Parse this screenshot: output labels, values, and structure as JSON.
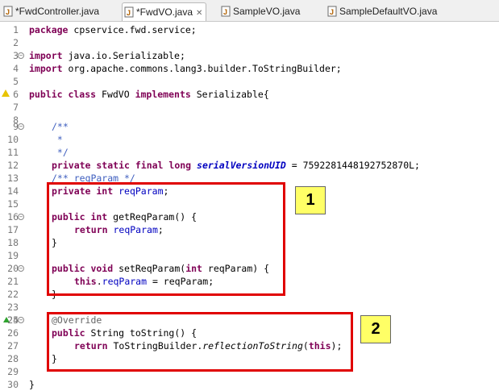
{
  "tabs": [
    {
      "label": "*FwdController.java",
      "active": false
    },
    {
      "label": "*FwdVO.java",
      "active": true
    },
    {
      "label": "SampleVO.java",
      "active": false
    },
    {
      "label": "SampleDefaultVO.java",
      "active": false
    }
  ],
  "line_numbers": [
    "1",
    "2",
    "3",
    "4",
    "5",
    "6",
    "7",
    "8",
    "9",
    "10",
    "11",
    "12",
    "13",
    "14",
    "15",
    "16",
    "17",
    "18",
    "19",
    "20",
    "21",
    "22",
    "23",
    "24",
    "25",
    "26",
    "27",
    "28",
    "29",
    "30"
  ],
  "code": {
    "l1_kw": "package",
    "l1_rest": " cpservice.fwd.service;",
    "l3_kw": "import",
    "l3_rest": " java.io.Serializable;",
    "l4_kw": "import",
    "l4_rest": " org.apache.commons.lang3.builder.ToStringBuilder;",
    "l6_kw1": "public class",
    "l6_mid": " FwdVO ",
    "l6_kw2": "implements",
    "l6_rest": " Serializable{",
    "l9": "/**",
    "l10": " *",
    "l11": " */",
    "l12_kw": "private static final long",
    "l12_field": "serialVersionUID",
    "l12_rest": " = 7592281448192752870L;",
    "l13": "/** reqParam */",
    "l14_kw": "private int",
    "l14_field": "reqParam",
    "l14_rest": ";",
    "l16_kw": "public int",
    "l16_rest": " getReqParam() {",
    "l17_kw": "return",
    "l17_field": "reqParam",
    "l17_rest": ";",
    "l18": "}",
    "l20_kw": "public void",
    "l20_mid": " setReqParam(",
    "l20_kw2": "int",
    "l20_rest": " reqParam) {",
    "l21_kw": "this",
    "l21_dot": ".",
    "l21_field": "reqParam",
    "l21_rest": " = reqParam;",
    "l22": "}",
    "l25": "@Override",
    "l26_kw": "public",
    "l26_rest": " String toString() {",
    "l27_kw": "return",
    "l27_mid": " ToStringBuilder.",
    "l27_it": "reflectionToString",
    "l27_open": "(",
    "l27_kw2": "this",
    "l27_rest": ");",
    "l28": "}",
    "l30": "}"
  },
  "badges": {
    "one": "1",
    "two": "2"
  },
  "colors": {
    "keyword": "#7f0055",
    "comment": "#3f5fbf",
    "field": "#0000c0",
    "annotation": "#646464",
    "highlight_box": "#e00000",
    "badge_bg": "#ffff66"
  },
  "icons": {
    "tab_file": "java-file-icon",
    "warning": "warning-icon",
    "override": "override-marker-icon"
  }
}
